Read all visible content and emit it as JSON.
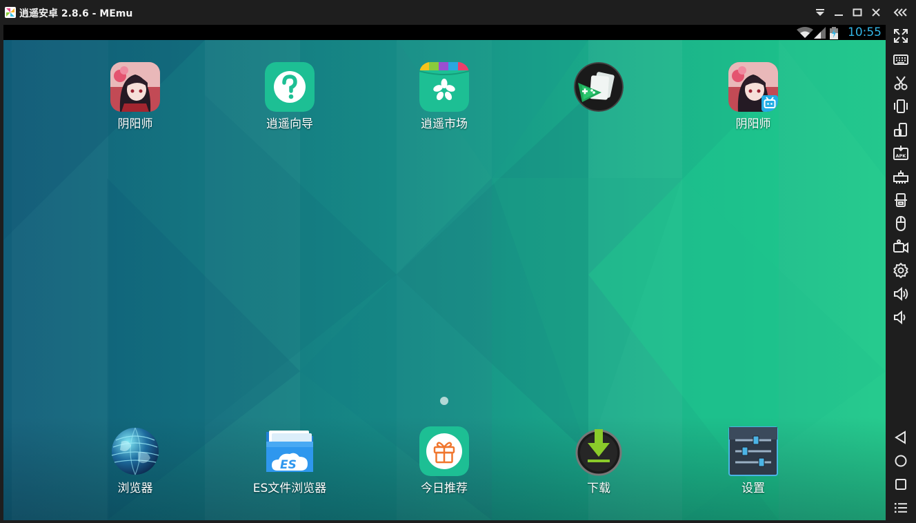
{
  "window": {
    "title": "逍遥安卓 2.8.6 - MEmu",
    "controls": [
      "dropdown-icon",
      "minimize-icon",
      "maximize-icon",
      "close-icon",
      "collapse-sidebar-icon"
    ]
  },
  "status_bar": {
    "time": "10:55",
    "icons": [
      "wifi-icon",
      "signal-icon",
      "battery-charging-icon"
    ],
    "time_color": "#33b5e5"
  },
  "home": {
    "top_apps": [
      {
        "label": "阴阳师",
        "icon": "onmyoji-icon"
      },
      {
        "label": "逍遥向导",
        "icon": "help-question-icon"
      },
      {
        "label": "逍遥市场",
        "icon": "memu-market-icon"
      },
      {
        "label": "",
        "icon": "game-center-icon"
      },
      {
        "label": "阴阳师",
        "icon": "onmyoji-bilibili-icon"
      }
    ],
    "dock_apps": [
      {
        "label": "浏览器",
        "icon": "globe-browser-icon"
      },
      {
        "label": "ES文件浏览器",
        "icon": "es-file-explorer-icon"
      },
      {
        "label": "今日推荐",
        "icon": "gift-icon"
      },
      {
        "label": "下载",
        "icon": "download-icon"
      },
      {
        "label": "设置",
        "icon": "settings-sliders-icon"
      }
    ],
    "page_indicator": {
      "current": 1,
      "total": 1
    }
  },
  "sidebar": {
    "tools": [
      "fullscreen-icon",
      "keyboard-icon",
      "scissors-icon",
      "shake-icon",
      "rotate-screen-icon",
      "apk-install-icon",
      "network-icon",
      "screenshot-icon",
      "mouse-icon",
      "video-record-icon",
      "settings-gear-icon",
      "volume-up-icon",
      "volume-down-icon"
    ],
    "nav": [
      "back-icon",
      "home-icon",
      "recent-apps-icon",
      "menu-icon"
    ]
  },
  "colors": {
    "wallpaper_dark": "#125f7a",
    "wallpaper_mid": "#168b86",
    "wallpaper_light": "#1ec98a",
    "chrome": "#1e1e1e",
    "app_green": "#1dbf94"
  }
}
